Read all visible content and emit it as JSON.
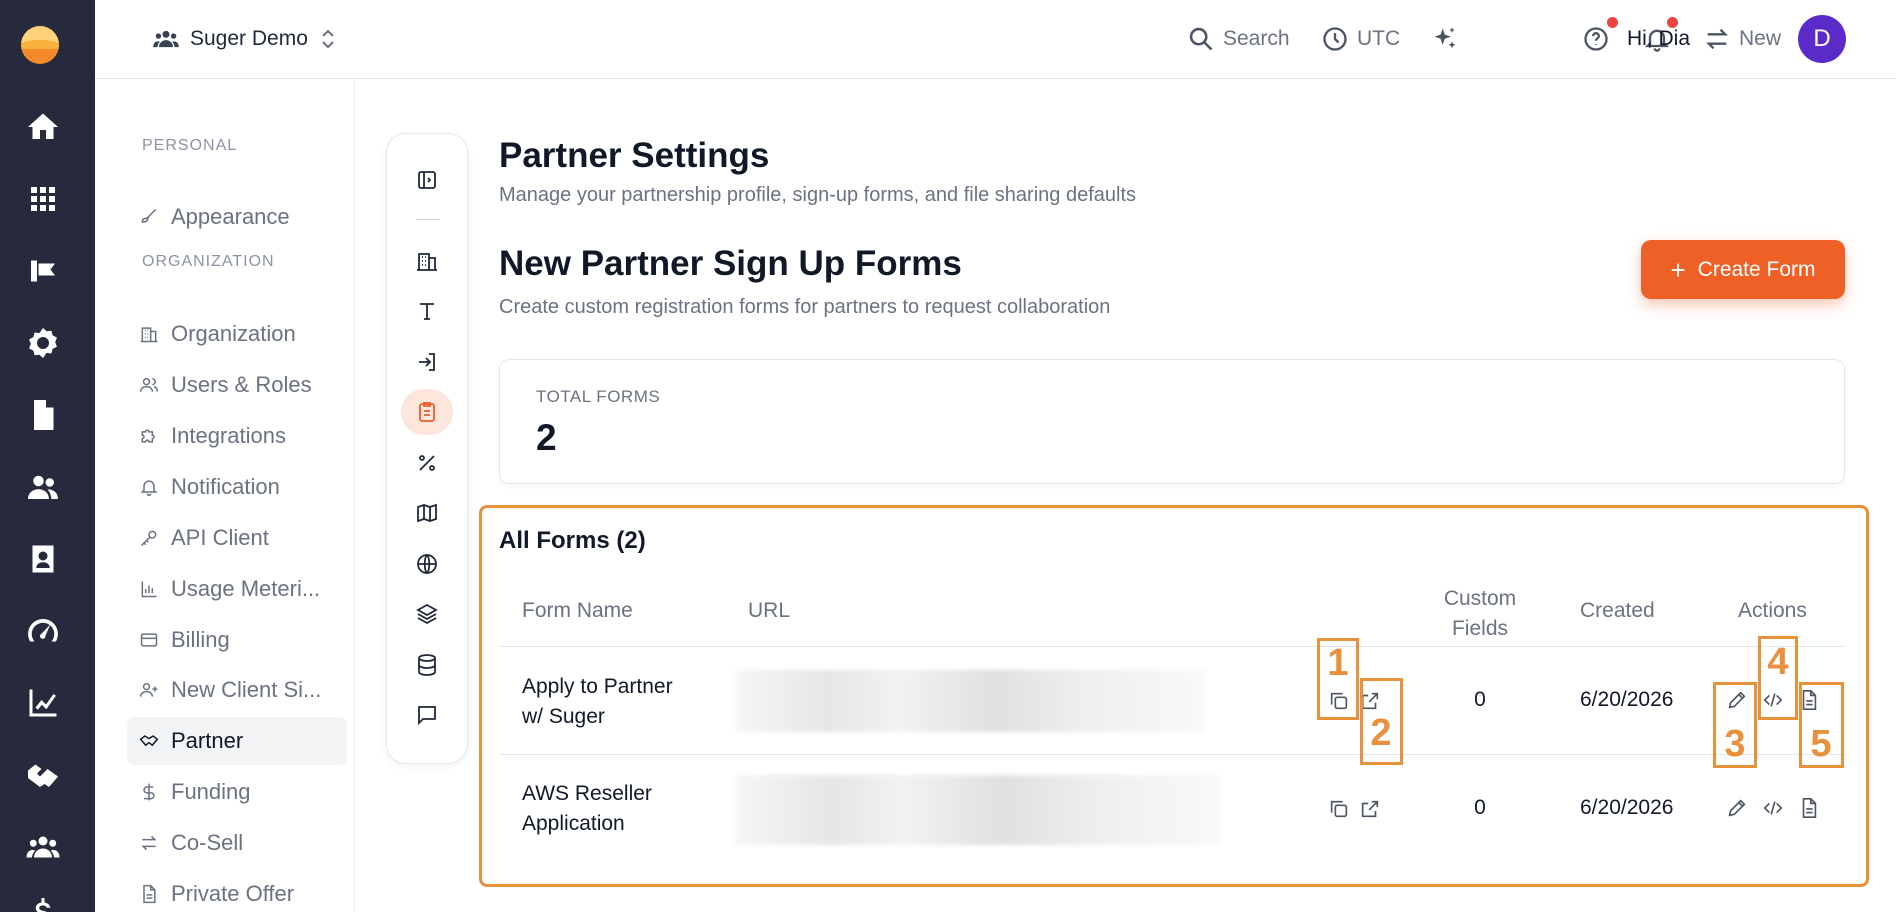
{
  "header": {
    "workspace": "Suger Demo",
    "search": "Search",
    "timezone": "UTC",
    "new": "New",
    "greeting": "Hi, Dia",
    "avatar_initial": "D"
  },
  "menu": {
    "group_personal": "PERSONAL",
    "group_org": "ORGANIZATION",
    "items": [
      {
        "label": "Appearance"
      },
      {
        "label": "Organization"
      },
      {
        "label": "Users & Roles"
      },
      {
        "label": "Integrations"
      },
      {
        "label": "Notification"
      },
      {
        "label": "API Client"
      },
      {
        "label": "Usage Meteri..."
      },
      {
        "label": "Billing"
      },
      {
        "label": "New Client Si..."
      },
      {
        "label": "Partner"
      },
      {
        "label": "Funding"
      },
      {
        "label": "Co-Sell"
      },
      {
        "label": "Private Offer"
      }
    ]
  },
  "page": {
    "title": "Partner Settings",
    "subtitle": "Manage your partnership profile, sign-up forms, and file sharing defaults",
    "section_title": "New Partner Sign Up Forms",
    "section_subtitle": "Create custom registration forms for partners to request collaboration",
    "create_button": "Create Form"
  },
  "stats": {
    "label": "TOTAL FORMS",
    "value": "2"
  },
  "forms": {
    "title": "All Forms (2)",
    "columns": {
      "name": "Form Name",
      "url": "URL",
      "custom_fields_1": "Custom",
      "custom_fields_2": "Fields",
      "created": "Created",
      "actions": "Actions"
    },
    "rows": [
      {
        "name_1": "Apply to Partner",
        "name_2": "w/ Suger",
        "custom_fields": "0",
        "created": "6/20/2026"
      },
      {
        "name_1": "AWS Reseller",
        "name_2": "Application",
        "custom_fields": "0",
        "created": "6/20/2026"
      }
    ]
  },
  "annotations": [
    "1",
    "2",
    "3",
    "4",
    "5"
  ],
  "colors": {
    "accent": "#ef6027",
    "annotation": "#e8913d",
    "rail": "#262a3c",
    "avatar": "#5b2bc9"
  }
}
